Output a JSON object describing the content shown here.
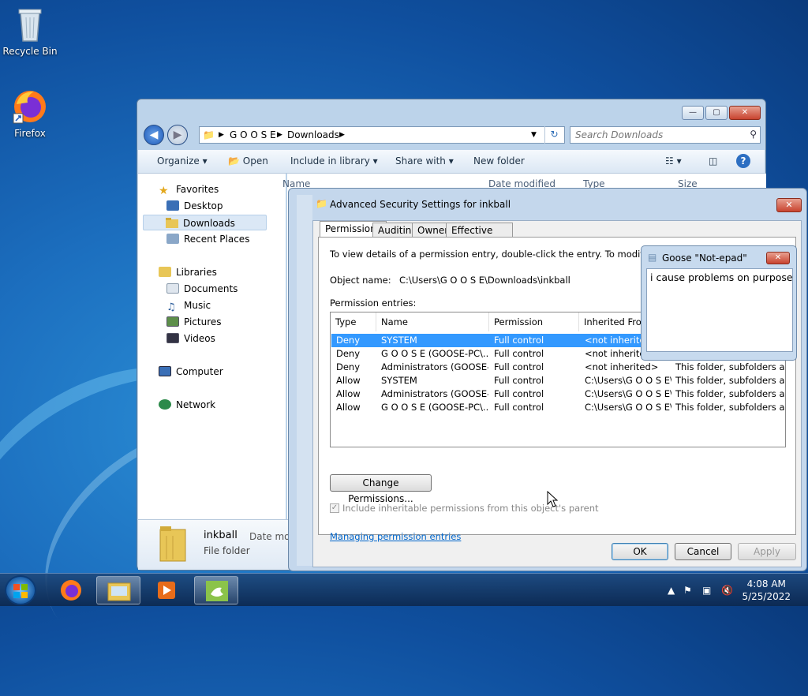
{
  "desktop": {
    "icons": [
      {
        "label": "Recycle Bin"
      },
      {
        "label": "Firefox"
      }
    ]
  },
  "explorer": {
    "breadcrumb": [
      "G O O S E",
      "Downloads"
    ],
    "search_placeholder": "Search Downloads",
    "toolbar": {
      "organize": "Organize",
      "open": "Open",
      "include": "Include in library",
      "share": "Share with",
      "newfolder": "New folder"
    },
    "nav": {
      "favorites": "Favorites",
      "desktop": "Desktop",
      "downloads": "Downloads",
      "recent": "Recent Places",
      "libraries": "Libraries",
      "documents": "Documents",
      "music": "Music",
      "pictures": "Pictures",
      "videos": "Videos",
      "computer": "Computer",
      "network": "Network"
    },
    "columns": {
      "name": "Name",
      "date": "Date modified",
      "type": "Type",
      "size": "Size"
    },
    "details": {
      "name": "inkball",
      "type": "File folder",
      "date_label": "Date moc"
    }
  },
  "security": {
    "title": "Advanced Security Settings for inkball",
    "tabs": [
      "Permissions",
      "Auditing",
      "Owner",
      "Effective Permissions"
    ],
    "info": "To view details of a permission entry, double-click the entry. To modify permissions, c",
    "object_label": "Object name:",
    "object_value": "C:\\Users\\G O O S E\\Downloads\\inkball",
    "entries_label": "Permission entries:",
    "headers": [
      "Type",
      "Name",
      "Permission",
      "Inherited From"
    ],
    "rows": [
      {
        "type": "Deny",
        "name": "SYSTEM",
        "permission": "Full control",
        "inherited": "<not inherited>",
        "applies": ""
      },
      {
        "type": "Deny",
        "name": "G O O S E (GOOSE-PC\\...",
        "permission": "Full control",
        "inherited": "<not inherited>",
        "applies": ""
      },
      {
        "type": "Deny",
        "name": "Administrators (GOOSE-P...",
        "permission": "Full control",
        "inherited": "<not inherited>",
        "applies": "This folder, subfolders and..."
      },
      {
        "type": "Allow",
        "name": "SYSTEM",
        "permission": "Full control",
        "inherited": "C:\\Users\\G O O S E\\",
        "applies": "This folder, subfolders and..."
      },
      {
        "type": "Allow",
        "name": "Administrators (GOOSE-P...",
        "permission": "Full control",
        "inherited": "C:\\Users\\G O O S E\\",
        "applies": "This folder, subfolders and..."
      },
      {
        "type": "Allow",
        "name": "G O O S E (GOOSE-PC\\...",
        "permission": "Full control",
        "inherited": "C:\\Users\\G O O S E\\",
        "applies": "This folder, subfolders and..."
      }
    ],
    "change_button": "Change Permissions...",
    "inherit_checkbox": "Include inheritable permissions from this object's parent",
    "link": "Managing permission entries",
    "ok": "OK",
    "cancel": "Cancel",
    "apply": "Apply"
  },
  "notepad": {
    "title": "Goose \"Not-epad\"",
    "text": "i cause problems on purpose"
  },
  "taskbar": {
    "time": "4:08 AM",
    "date": "5/25/2022"
  }
}
